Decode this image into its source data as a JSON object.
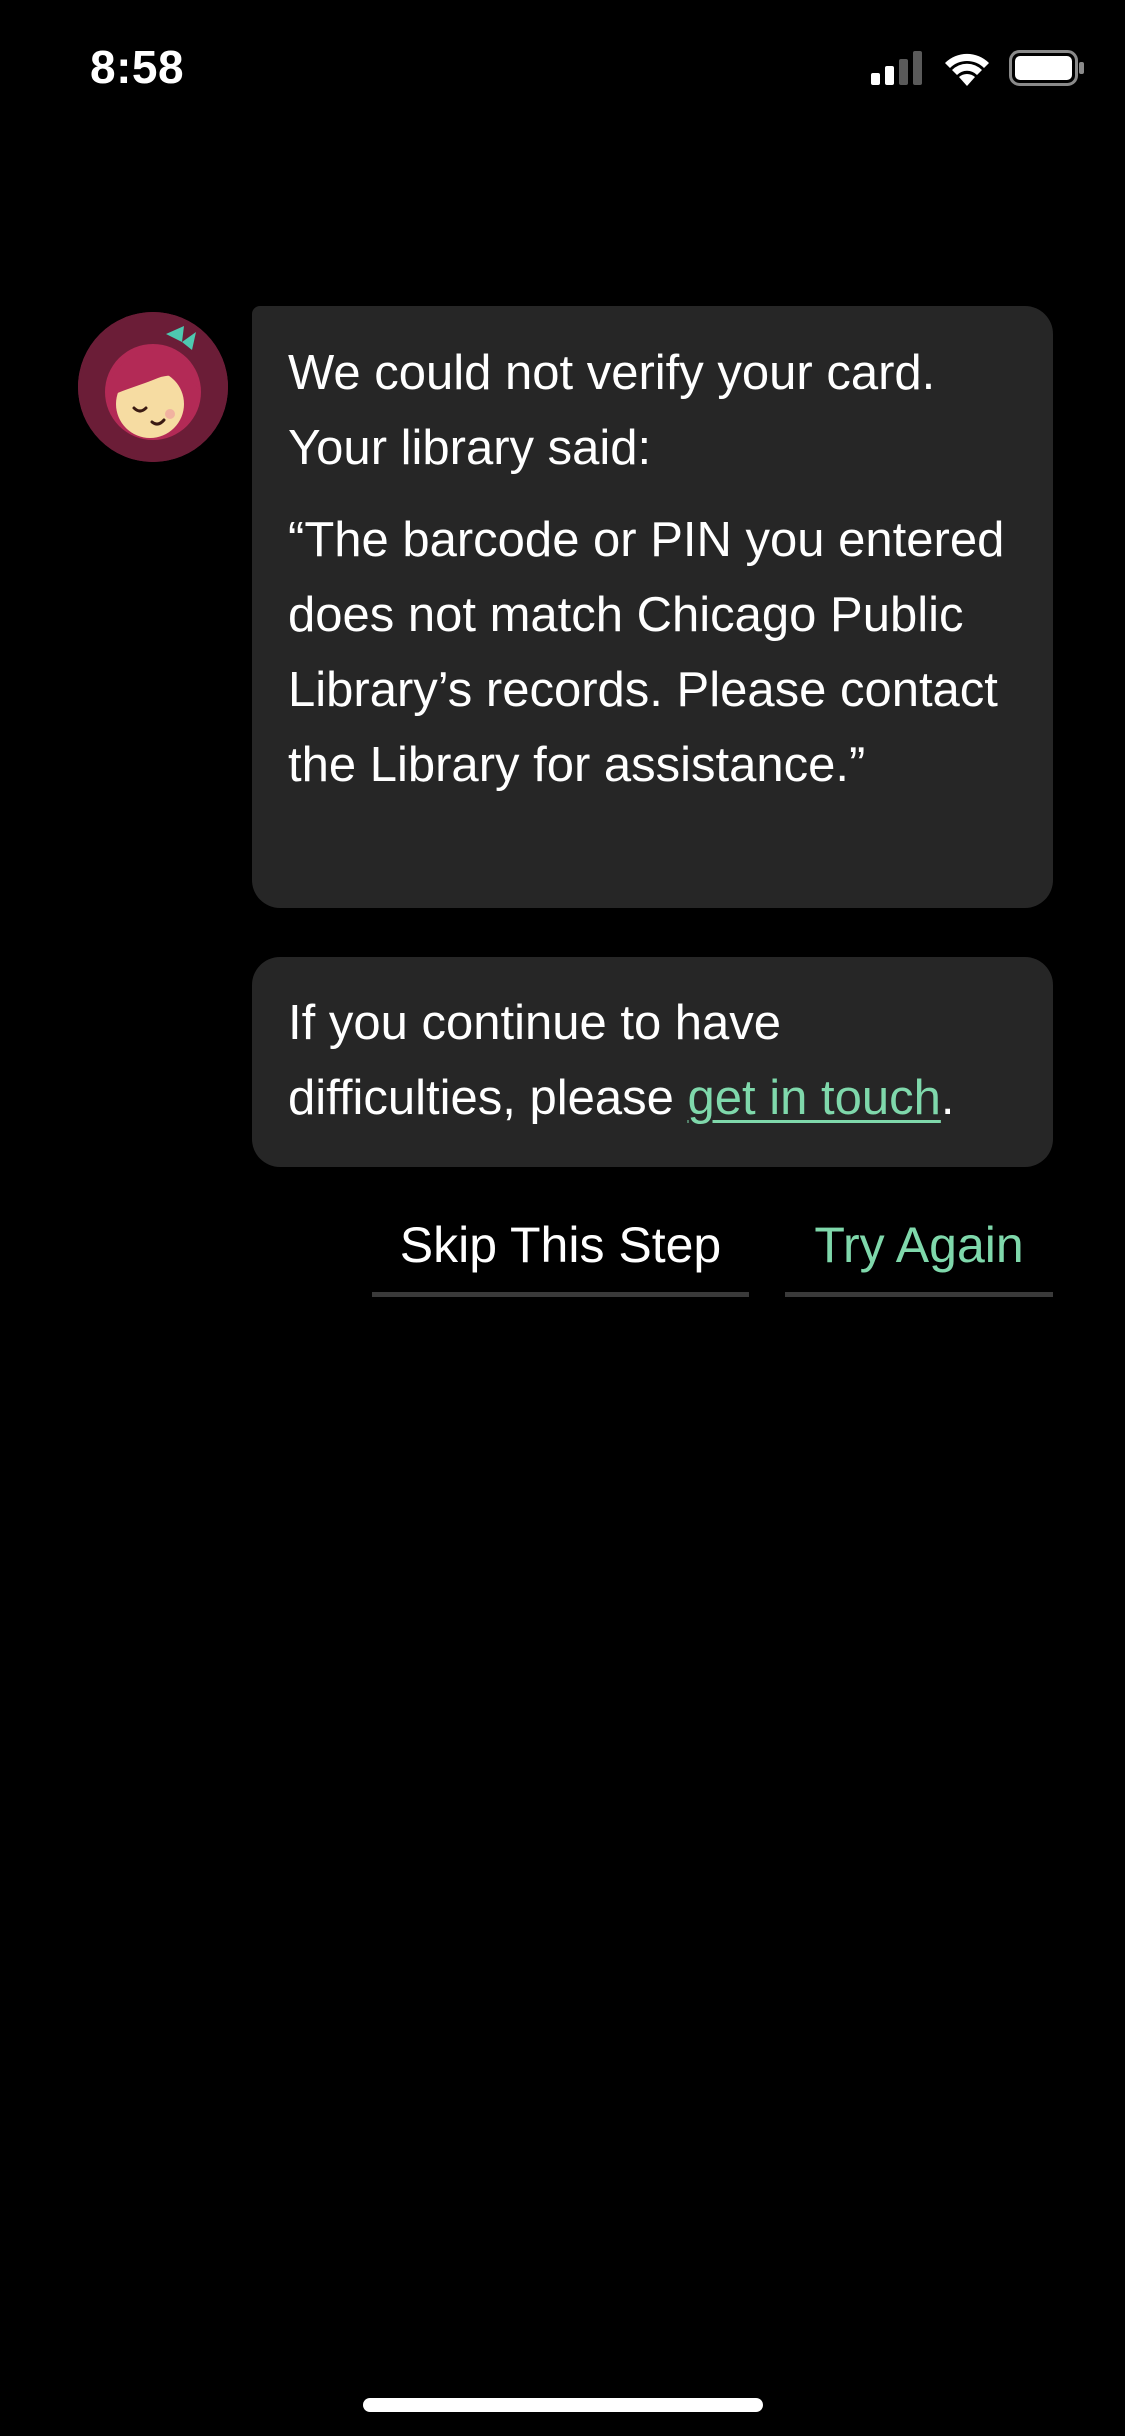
{
  "status_bar": {
    "time": "8:58",
    "icons": [
      "cellular-signal-icon",
      "wifi-icon",
      "battery-icon"
    ]
  },
  "avatar": {
    "icon": "libby-avatar-icon"
  },
  "messages": {
    "first": {
      "line1": "We could not verify your card. Your library said:",
      "quote": "“The barcode or PIN you entered does not match Chicago Public Library’s records. Please contact the Library for assistance.”"
    },
    "second": {
      "prefix": "If you continue to have difficulties, please ",
      "link": "get in touch",
      "suffix": "."
    }
  },
  "actions": {
    "skip_label": "Skip This Step",
    "retry_label": "Try Again"
  },
  "colors": {
    "background": "#000000",
    "bubble": "#262626",
    "accent": "#7fd8ab",
    "avatar_bg": "#6b1d37"
  }
}
